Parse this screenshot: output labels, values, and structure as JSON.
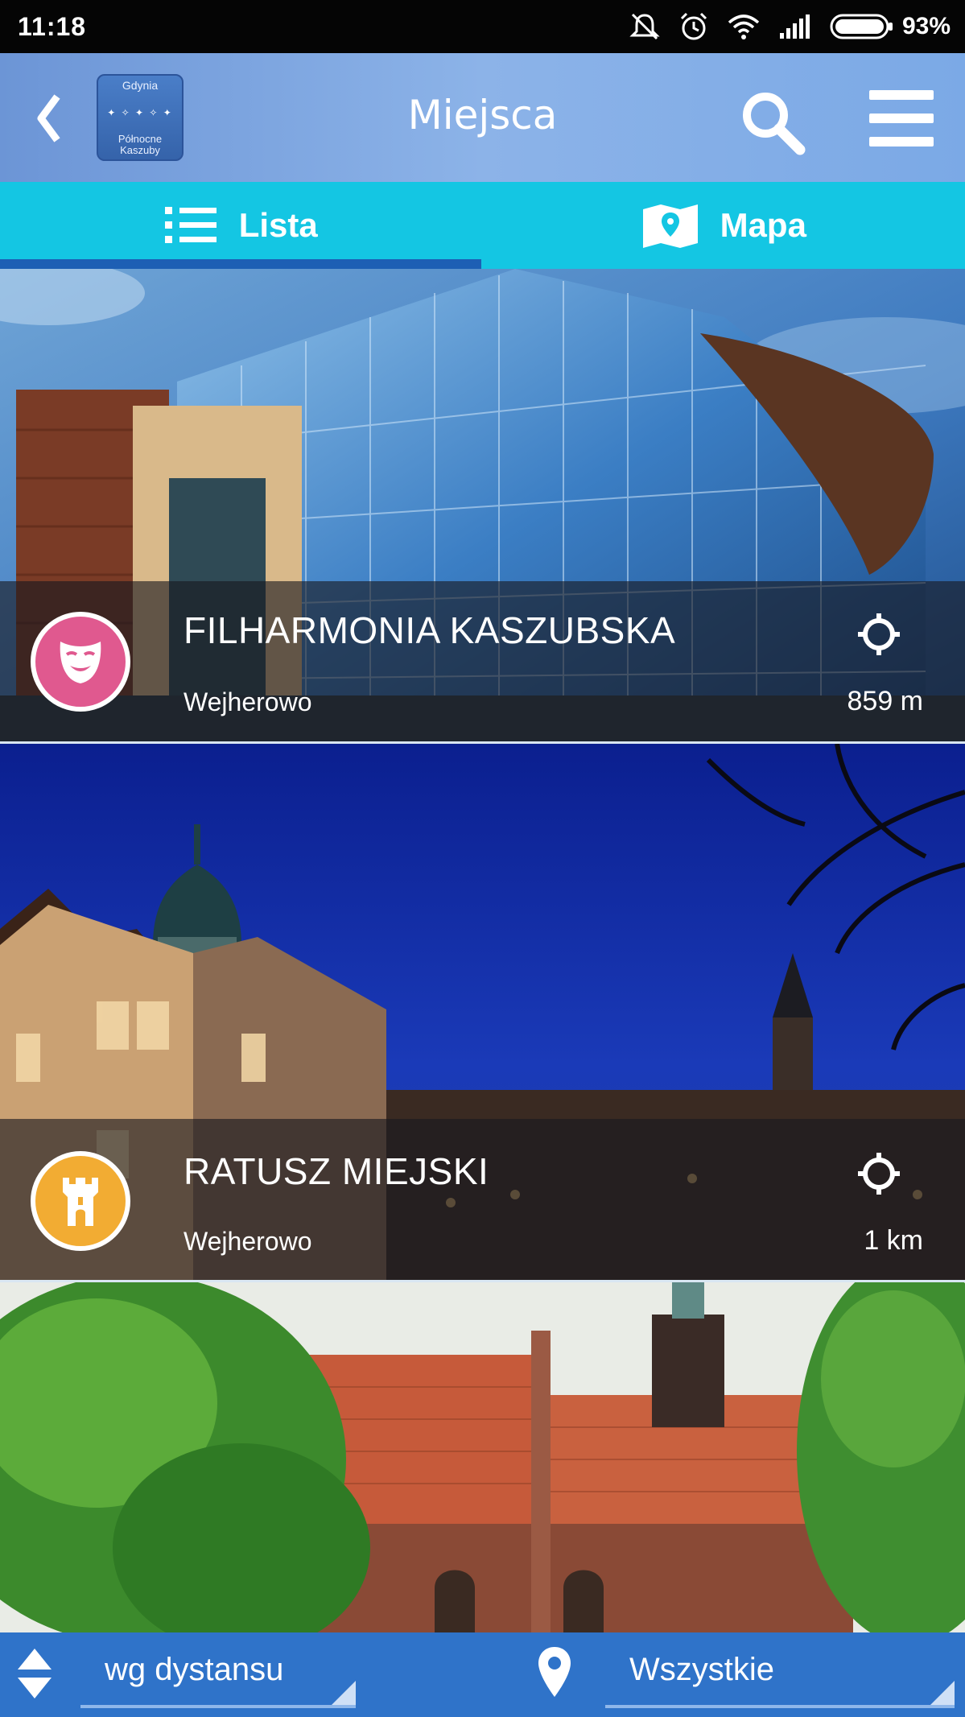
{
  "status_bar": {
    "time": "11:18",
    "battery_pct": "93%",
    "icons": [
      "mute-icon",
      "alarm-icon",
      "wifi-icon",
      "signal-icon",
      "battery-icon"
    ]
  },
  "app_bar": {
    "title": "Miejsca",
    "logo": {
      "top_text": "Gdynia",
      "bottom_text_1": "Północne",
      "bottom_text_2": "Kaszuby"
    },
    "icons": {
      "back": "chevron-left-icon",
      "search": "search-icon",
      "menu": "hamburger-menu-icon"
    }
  },
  "tabs": [
    {
      "label": "Lista",
      "icon": "list-icon",
      "active": true
    },
    {
      "label": "Mapa",
      "icon": "map-pin-icon",
      "active": false
    }
  ],
  "places": [
    {
      "name": "FILHARMONIA KASZUBSKA",
      "city": "Wejherowo",
      "distance": "859 m",
      "category_icon": "theater-mask-icon",
      "category_color": "#e0598f"
    },
    {
      "name": "RATUSZ MIEJSKI",
      "city": "Wejherowo",
      "distance": "1 km",
      "category_icon": "castle-tower-icon",
      "category_color": "#f2ac33"
    },
    {
      "name": "",
      "city": "",
      "distance": "",
      "category_icon": "",
      "category_color": ""
    }
  ],
  "bottom_bar": {
    "sort_label": "wg dystansu",
    "filter_label": "Wszystkie"
  },
  "colors": {
    "app_bar": "#7ba9e6",
    "tabs": "#14c6e3",
    "tab_indicator": "#1d5fb4",
    "bottom_bar": "#2f73c9"
  }
}
